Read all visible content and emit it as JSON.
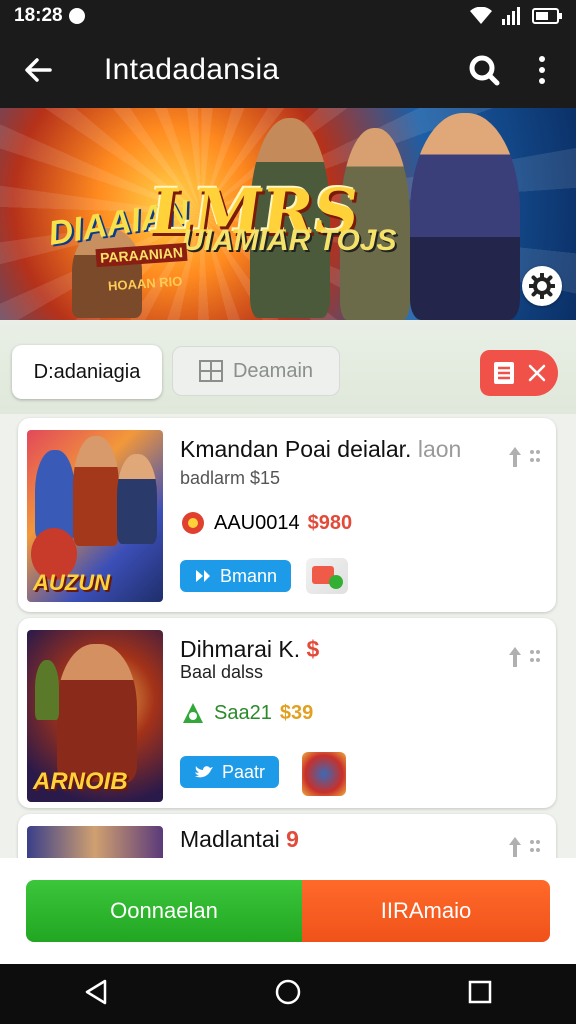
{
  "status_bar": {
    "time": "18:28",
    "icons": [
      "notification-icon",
      "wifi-icon",
      "signal-icon",
      "battery-icon"
    ]
  },
  "app_bar": {
    "title": "Intadadansia",
    "icons": [
      "back-arrow-icon",
      "search-icon",
      "more-vert-icon"
    ]
  },
  "banner": {
    "logo_top": "DIAAIAN",
    "logo_main": "LMRS",
    "logo_sub": "UIAMIAR TOJS",
    "logo_sub2": "PARAANIAN",
    "logo_sub3": "HOAAN RIO",
    "icon": "gear-icon"
  },
  "tabs": {
    "active_label": "D:adaniagia",
    "inactive_label": "Deamain",
    "inactive_icon": "grid-icon",
    "filter_icons": [
      "list-icon",
      "close-icon"
    ]
  },
  "items": [
    {
      "name": "Kmandan Poai deialar.",
      "name_faded": "laon",
      "subtitle": "badlarm $15",
      "price_label": "AAU0014",
      "price": "$980",
      "button_label": "Bmann",
      "button_icon": "controller-icon",
      "thumb_title": "AUZUN"
    },
    {
      "name": "Dihmarai K.",
      "name_suffix": "$",
      "subtitle": "Baal dalss",
      "price_label": "Saa21",
      "price": "$39",
      "button_label": "Paatr",
      "button_icon": "bird-icon",
      "thumb_title": "ARNOIB"
    },
    {
      "name": "Madlantai",
      "name_suffix": "9"
    }
  ],
  "cta": {
    "left_label": "Oonnaelan",
    "right_label": "IIRAmaio"
  },
  "nav": {
    "icons": [
      "back-triangle-icon",
      "home-circle-icon",
      "recents-square-icon"
    ]
  },
  "colors": {
    "primary_green": "#22a622",
    "primary_orange": "#f0521a",
    "accent_blue": "#1e9be8",
    "price_red": "#e24a3a",
    "app_bar_bg": "#1b1b1b"
  }
}
